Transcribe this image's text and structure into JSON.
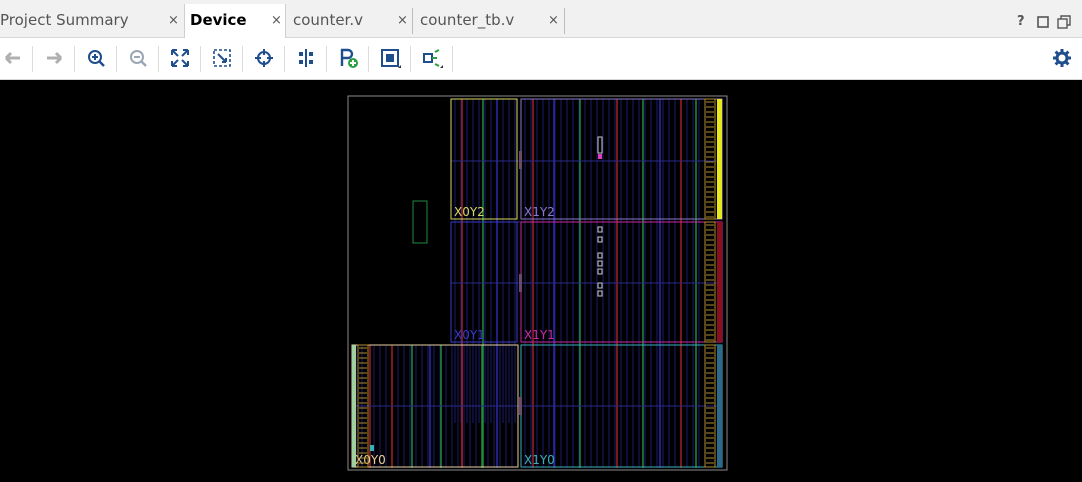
{
  "tabs": [
    {
      "label": "Project Summary",
      "close": "×",
      "active": false
    },
    {
      "label": "Device",
      "close": "×",
      "active": true
    },
    {
      "label": "counter.v",
      "close": "×",
      "active": false
    },
    {
      "label": "counter_tb.v",
      "close": "×",
      "active": false
    }
  ],
  "window_controls": {
    "help": "?",
    "restore": "□",
    "maximize": "⧉"
  },
  "toolbar_icons": [
    "back-icon",
    "forward-icon",
    "zoom-in-icon",
    "zoom-out-icon",
    "zoom-fit-icon",
    "zoom-selection-icon",
    "crosshair-icon",
    "align-icon",
    "place-ports-icon",
    "routing-resources-icon",
    "select-cells-icon",
    "settings-icon"
  ],
  "device": {
    "regions": [
      {
        "label": "X0Y2",
        "color": "#d8d860"
      },
      {
        "label": "X1Y2",
        "color": "#8a7ac8"
      },
      {
        "label": "X0Y1",
        "color": "#3a3ac8"
      },
      {
        "label": "X1Y1",
        "color": "#c82aa0"
      },
      {
        "label": "X0Y0",
        "color": "#e8d0a0"
      },
      {
        "label": "X1Y0",
        "color": "#3ab0b8"
      }
    ],
    "colors": {
      "outline": "#8a8a8a",
      "column_red": "#a0202a",
      "column_green": "#208a40",
      "column_blue": "#2a2ab0",
      "io": "#b08a30",
      "highlight": "#e8e820"
    }
  }
}
